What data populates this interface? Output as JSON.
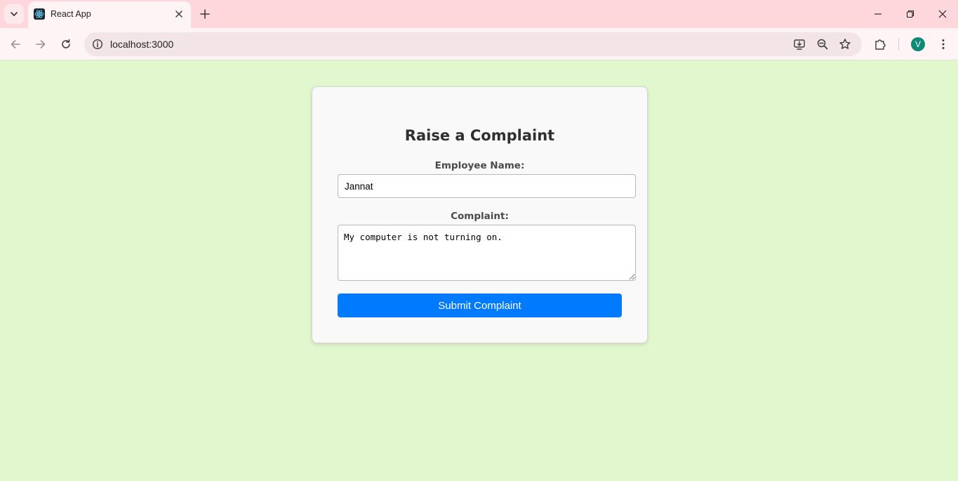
{
  "browser": {
    "tab_title": "React App",
    "url": "localhost:3000",
    "profile_initial": "V"
  },
  "form": {
    "title": "Raise a Complaint",
    "name_label": "Employee Name:",
    "name_value": "Jannat",
    "complaint_label": "Complaint:",
    "complaint_value": "My computer is not turning on.",
    "submit_label": "Submit Complaint"
  },
  "colors": {
    "page_background": "#e1f8ce",
    "titlebar": "#fed7dd",
    "button_primary": "#007bff",
    "avatar": "#0f8a74"
  },
  "icons": {
    "favicon": "react-logo-icon",
    "site_info": "info-icon",
    "omnibox_actions": [
      "install-app-icon",
      "zoom-out-icon",
      "bookmark-star-icon"
    ],
    "toolbar": [
      "extensions-puzzle-icon",
      "kebab-menu-icon"
    ]
  }
}
